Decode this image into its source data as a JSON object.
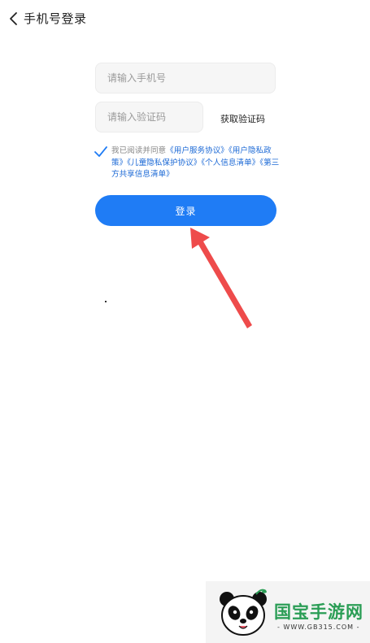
{
  "header": {
    "title": "手机号登录"
  },
  "form": {
    "phone_placeholder": "请输入手机号",
    "phone_value": "",
    "code_placeholder": "请输入验证码",
    "code_value": "",
    "get_code_label": "获取验证码",
    "login_label": "登录"
  },
  "agreement": {
    "checked": true,
    "prefix": "我已阅读并同意",
    "links": [
      "《用户服务协议》",
      "《用户隐私政策》",
      "《儿童隐私保护协议》",
      "《个人信息清单》",
      "《第三方共享信息清单》"
    ]
  },
  "watermark": {
    "brand": "国宝手游网",
    "url": "- WWW.GB315.COM -"
  },
  "colors": {
    "primary": "#1f7cf5",
    "link": "#1d6ad6",
    "arrow": "#ee4b4b",
    "watermark_green": "#2a9d55"
  }
}
